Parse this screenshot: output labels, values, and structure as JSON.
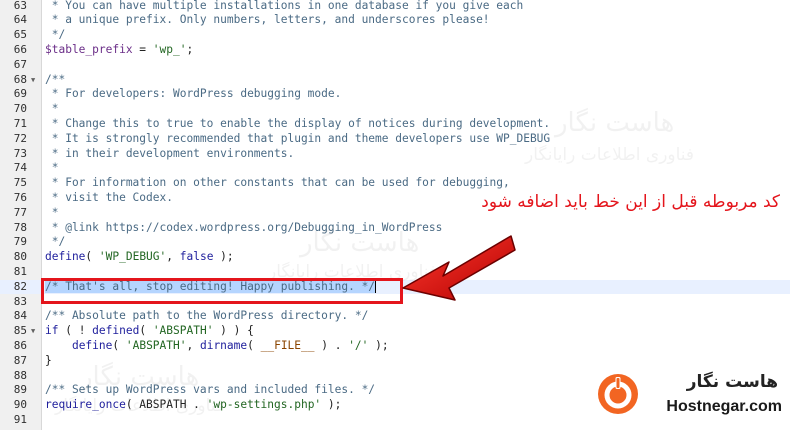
{
  "editor": {
    "lines": [
      {
        "num": "63",
        "fold": "",
        "tokens": [
          {
            "t": " * You can have multiple installations in one database if you give each",
            "c": "tk-comment"
          }
        ]
      },
      {
        "num": "64",
        "fold": "",
        "tokens": [
          {
            "t": " * a unique prefix. Only numbers, letters, and underscores please!",
            "c": "tk-comment"
          }
        ]
      },
      {
        "num": "65",
        "fold": "",
        "tokens": [
          {
            "t": " */",
            "c": "tk-comment"
          }
        ]
      },
      {
        "num": "66",
        "fold": "",
        "tokens": [
          {
            "t": "$table_prefix",
            "c": "tk-var"
          },
          {
            "t": " = ",
            "c": ""
          },
          {
            "t": "'wp_'",
            "c": "tk-string"
          },
          {
            "t": ";",
            "c": ""
          }
        ]
      },
      {
        "num": "67",
        "fold": "",
        "tokens": []
      },
      {
        "num": "68",
        "fold": "▼",
        "tokens": [
          {
            "t": "/**",
            "c": "tk-comment"
          }
        ]
      },
      {
        "num": "69",
        "fold": "",
        "tokens": [
          {
            "t": " * For developers: WordPress debugging mode.",
            "c": "tk-comment"
          }
        ]
      },
      {
        "num": "70",
        "fold": "",
        "tokens": [
          {
            "t": " *",
            "c": "tk-comment"
          }
        ]
      },
      {
        "num": "71",
        "fold": "",
        "tokens": [
          {
            "t": " * Change this to true to enable the display of notices during development.",
            "c": "tk-comment"
          }
        ]
      },
      {
        "num": "72",
        "fold": "",
        "tokens": [
          {
            "t": " * It is strongly recommended that plugin and theme developers use WP_DEBUG",
            "c": "tk-comment"
          }
        ]
      },
      {
        "num": "73",
        "fold": "",
        "tokens": [
          {
            "t": " * in their development environments.",
            "c": "tk-comment"
          }
        ]
      },
      {
        "num": "74",
        "fold": "",
        "tokens": [
          {
            "t": " *",
            "c": "tk-comment"
          }
        ]
      },
      {
        "num": "75",
        "fold": "",
        "tokens": [
          {
            "t": " * For information on other constants that can be used for debugging,",
            "c": "tk-comment"
          }
        ]
      },
      {
        "num": "76",
        "fold": "",
        "tokens": [
          {
            "t": " * visit the Codex.",
            "c": "tk-comment"
          }
        ]
      },
      {
        "num": "77",
        "fold": "",
        "tokens": [
          {
            "t": " *",
            "c": "tk-comment"
          }
        ]
      },
      {
        "num": "78",
        "fold": "",
        "tokens": [
          {
            "t": " * @link https://codex.wordpress.org/Debugging_in_WordPress",
            "c": "tk-comment"
          }
        ]
      },
      {
        "num": "79",
        "fold": "",
        "tokens": [
          {
            "t": " */",
            "c": "tk-comment"
          }
        ]
      },
      {
        "num": "80",
        "fold": "",
        "tokens": [
          {
            "t": "define",
            "c": "tk-keyword"
          },
          {
            "t": "( ",
            "c": ""
          },
          {
            "t": "'WP_DEBUG'",
            "c": "tk-string"
          },
          {
            "t": ", ",
            "c": ""
          },
          {
            "t": "false",
            "c": "tk-keyword"
          },
          {
            "t": " );",
            "c": ""
          }
        ]
      },
      {
        "num": "81",
        "fold": "",
        "tokens": []
      },
      {
        "num": "82",
        "fold": "",
        "active": true,
        "tokens": [
          {
            "t": "/* That's all, stop editing! Happy publishing. */",
            "c": "tk-comment sel"
          }
        ]
      },
      {
        "num": "83",
        "fold": "",
        "tokens": []
      },
      {
        "num": "84",
        "fold": "",
        "tokens": [
          {
            "t": "/** Absolute path to the WordPress directory. */",
            "c": "tk-comment"
          }
        ]
      },
      {
        "num": "85",
        "fold": "▼",
        "tokens": [
          {
            "t": "if",
            "c": "tk-keyword"
          },
          {
            "t": " ( ! ",
            "c": ""
          },
          {
            "t": "defined",
            "c": "tk-keyword"
          },
          {
            "t": "( ",
            "c": ""
          },
          {
            "t": "'ABSPATH'",
            "c": "tk-string"
          },
          {
            "t": " ) ) {",
            "c": ""
          }
        ]
      },
      {
        "num": "86",
        "fold": "",
        "tokens": [
          {
            "t": "    ",
            "c": ""
          },
          {
            "t": "define",
            "c": "tk-keyword"
          },
          {
            "t": "( ",
            "c": ""
          },
          {
            "t": "'ABSPATH'",
            "c": "tk-string"
          },
          {
            "t": ", ",
            "c": ""
          },
          {
            "t": "dirname",
            "c": "tk-keyword"
          },
          {
            "t": "( ",
            "c": ""
          },
          {
            "t": "__FILE__",
            "c": "tk-const"
          },
          {
            "t": " ) . ",
            "c": ""
          },
          {
            "t": "'/'",
            "c": "tk-string"
          },
          {
            "t": " );",
            "c": ""
          }
        ]
      },
      {
        "num": "87",
        "fold": "",
        "tokens": [
          {
            "t": "}",
            "c": ""
          }
        ]
      },
      {
        "num": "88",
        "fold": "",
        "tokens": []
      },
      {
        "num": "89",
        "fold": "",
        "tokens": [
          {
            "t": "/** Sets up WordPress vars and included files. */",
            "c": "tk-comment"
          }
        ]
      },
      {
        "num": "90",
        "fold": "",
        "tokens": [
          {
            "t": "require_once",
            "c": "tk-keyword"
          },
          {
            "t": "( ABSPATH . ",
            "c": ""
          },
          {
            "t": "'wp-settings.php'",
            "c": "tk-string"
          },
          {
            "t": " );",
            "c": ""
          }
        ]
      },
      {
        "num": "91",
        "fold": "",
        "tokens": []
      }
    ]
  },
  "annotation": {
    "text": "کد مربوطه قبل از این خط باید اضافه شود",
    "color": "#e4151c"
  },
  "watermark": {
    "brand_fa": "هاست نگار",
    "tagline_fa": "فناوری اطلاعات رایانگار"
  },
  "logo": {
    "brand_fa": "هاست نگار",
    "brand_en": "Hostnegar.com",
    "accent": "#f26522",
    "icon": "hostnegar-logo-icon"
  },
  "colors": {
    "highlight": "#e4151c",
    "selection": "#b5d5ff"
  }
}
